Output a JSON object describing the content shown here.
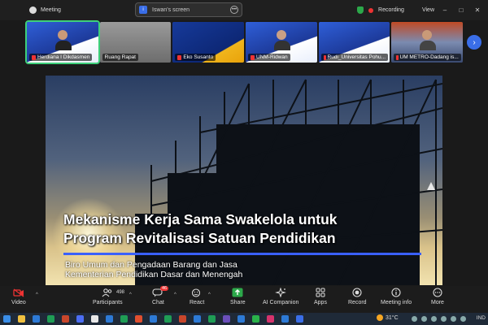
{
  "window": {
    "app_title": "Meeting",
    "screen_label": "Iswan's screen",
    "screen_icon_letter": "i",
    "recording_label": "Recording",
    "view_label": "View",
    "controls": [
      "–",
      "□",
      "✕"
    ]
  },
  "participants_strip": [
    {
      "name": "Herdiana I Dikdasmen",
      "muted": true,
      "active": true
    },
    {
      "name": "Ruang Rapat",
      "muted": false,
      "active": false
    },
    {
      "name": "Eko Susanto",
      "muted": true,
      "active": false
    },
    {
      "name": "UNM-Ridwan",
      "muted": true,
      "active": false
    },
    {
      "name": "Rudi_Universitas Pohu...",
      "muted": true,
      "active": false
    },
    {
      "name": "UM METRO-Dadang is...",
      "muted": true,
      "active": false
    }
  ],
  "slide": {
    "title_line1": "Mekanisme Kerja Sama Swakelola untuk",
    "title_line2": "Program Revitalisasi Satuan Pendidikan",
    "subtitle_line1": "Biro Umum dan Pengadaan Barang dan Jasa",
    "subtitle_line2": "Kementerian Pendidikan Dasar dan Menengah"
  },
  "toolbar": {
    "video": "Video",
    "participants": "Participants",
    "participants_count": "498",
    "chat": "Chat",
    "chat_badge": "46",
    "react": "React",
    "share": "Share",
    "ai_companion": "AI Companion",
    "apps": "Apps",
    "record": "Record",
    "meeting_info": "Meeting info",
    "more": "More"
  },
  "taskbar": {
    "temperature": "31°C",
    "language": "IND"
  },
  "colors": {
    "accent": "#3a6ee8",
    "active_border": "#3ed07a",
    "record_red": "#e33333",
    "share_green": "#2ca84a"
  }
}
